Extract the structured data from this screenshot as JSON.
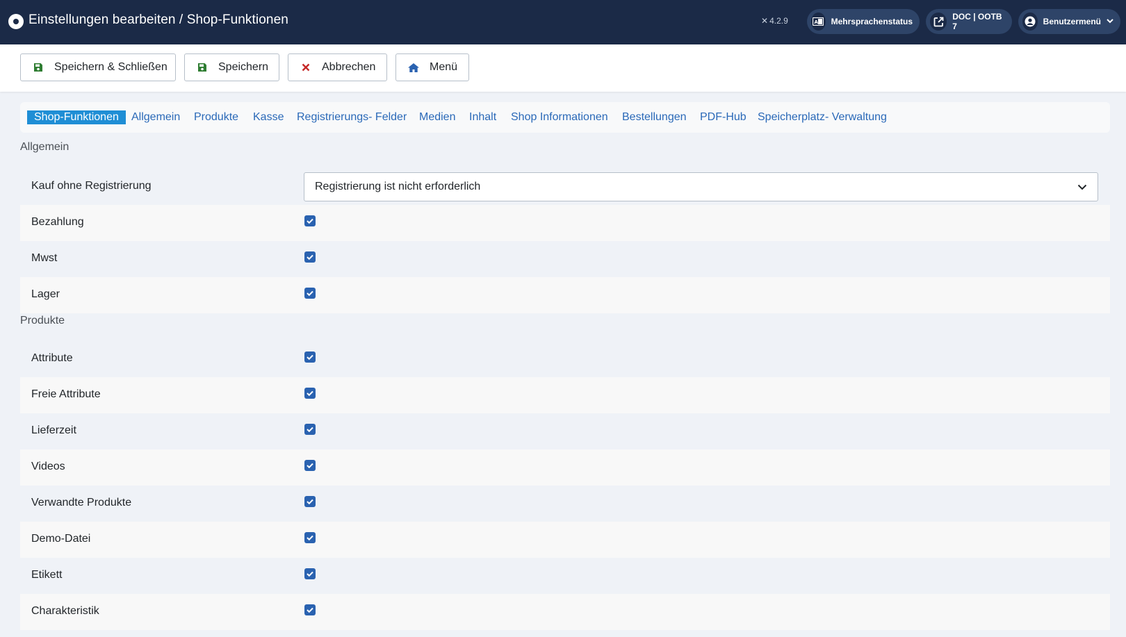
{
  "header": {
    "title": "Einstellungen bearbeiten / Shop-Funktionen",
    "version": "4.2.9",
    "pills": [
      {
        "label": "Mehrsprachenstatus",
        "icon": "language-icon"
      },
      {
        "label": "DOC | OOTB 7",
        "icon": "external-link-icon"
      },
      {
        "label": "Benutzermenü",
        "icon": "user-icon"
      }
    ]
  },
  "toolbar": {
    "save_close": "Speichern & Schließen",
    "save": "Speichern",
    "cancel": "Abbrechen",
    "menu": "Menü"
  },
  "tabs": [
    {
      "label": "Shop-Funktionen",
      "active": true
    },
    {
      "label": "Allgemein"
    },
    {
      "label": "Produkte"
    },
    {
      "label": "Kasse"
    },
    {
      "label": "Registrierungs- Felder"
    },
    {
      "label": "Medien"
    },
    {
      "label": "Inhalt"
    },
    {
      "label": "Shop Informationen"
    },
    {
      "label": "Bestellungen"
    },
    {
      "label": "PDF-Hub"
    },
    {
      "label": "Speicherplatz- Verwaltung"
    }
  ],
  "sections": {
    "general": {
      "title": "Allgemein",
      "purchase_label": "Kauf ohne Registrierung",
      "purchase_value": "Registrierung ist nicht erforderlich",
      "rows": [
        {
          "label": "Bezahlung",
          "checked": true
        },
        {
          "label": "Mwst",
          "checked": true
        },
        {
          "label": "Lager",
          "checked": true
        }
      ]
    },
    "products": {
      "title": "Produkte",
      "rows": [
        {
          "label": "Attribute",
          "checked": true
        },
        {
          "label": "Freie Attribute",
          "checked": true
        },
        {
          "label": "Lieferzeit",
          "checked": true
        },
        {
          "label": "Videos",
          "checked": true
        },
        {
          "label": "Verwandte Produkte",
          "checked": true
        },
        {
          "label": "Demo-Datei",
          "checked": true
        },
        {
          "label": "Etikett",
          "checked": true
        },
        {
          "label": "Charakteristik",
          "checked": true
        }
      ]
    }
  },
  "colors": {
    "header_bg": "#1b2a47",
    "pill_bg": "#2e4468",
    "tab_active": "#1f8ed5",
    "link": "#2a69b8",
    "checkbox": "#2a62b0",
    "save_icon": "#2f7d32",
    "cancel_icon": "#c52827",
    "menu_icon": "#2a62b0"
  }
}
